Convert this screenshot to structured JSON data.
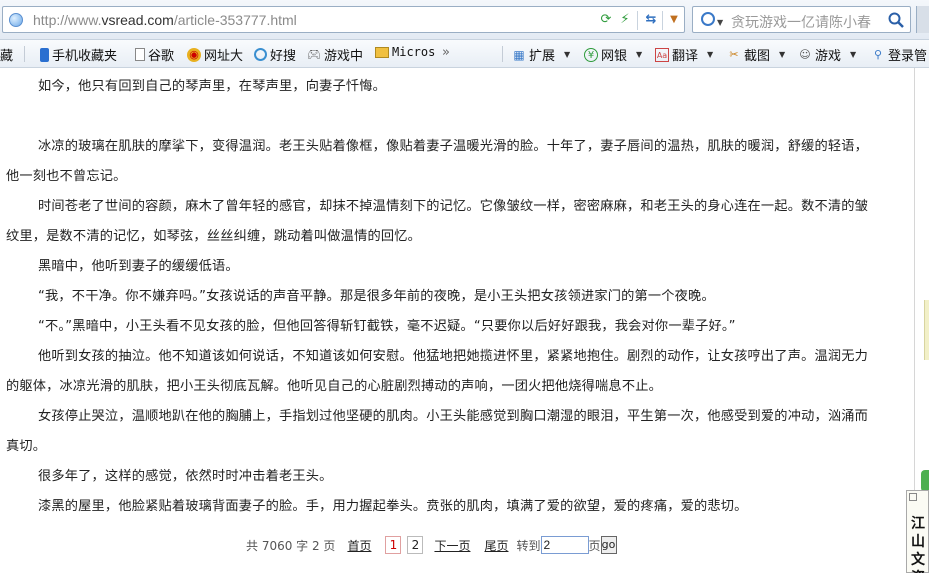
{
  "address_bar": {
    "url_prefix": "http://www.",
    "url_domain": "vsread.com",
    "url_path": "/article-353777.html"
  },
  "search": {
    "placeholder": "贪玩游戏一亿请陈小春"
  },
  "favorites": {
    "items": [
      {
        "label": "藏",
        "icon": "favorites-icon"
      },
      {
        "label": "手机收藏夹",
        "icon": "phone-icon"
      },
      {
        "label": "谷歌",
        "icon": "page-icon"
      },
      {
        "label": "网址大",
        "icon": "compass-icon"
      },
      {
        "label": "好搜",
        "icon": "search-icon"
      },
      {
        "label": "游戏中",
        "icon": "gamepad-icon"
      },
      {
        "label": "Micros",
        "icon": "folder-icon"
      }
    ],
    "overflow": "»",
    "tools": [
      {
        "label": "扩展",
        "icon": "grid-icon"
      },
      {
        "label": "网银",
        "icon": "yen-icon"
      },
      {
        "label": "翻译",
        "icon": "translate-icon"
      },
      {
        "label": "截图",
        "icon": "scissors-icon"
      },
      {
        "label": "游戏",
        "icon": "game-icon"
      },
      {
        "label": "登录管",
        "icon": "key-icon"
      }
    ]
  },
  "article": {
    "paragraphs": [
      "如今，他只有回到自己的琴声里，在琴声里，向妻子忏悔。",
      "冰凉的玻璃在肌肤的摩挲下，变得温润。老王头贴着像框，像贴着妻子温暖光滑的脸。十年了，妻子唇间的温热，肌肤的暖润，舒缓的轻语，他一刻也不曾忘记。",
      "时间苍老了世间的容颜，麻木了曾年轻的感官，却抹不掉温情刻下的记忆。它像皱纹一样，密密麻麻，和老王头的身心连在一起。数不清的皱纹里，是数不清的记忆，如琴弦，丝丝纠缠，跳动着叫做温情的回忆。",
      "黑暗中，他听到妻子的缓缓低语。",
      "“我，不干净。你不嫌弃吗。”女孩说话的声音平静。那是很多年前的夜晚，是小王头把女孩领进家门的第一个夜晚。",
      "“不。”黑暗中，小王头看不见女孩的脸，但他回答得斩钉截铁，毫不迟疑。“只要你以后好好跟我，我会对你一辈子好。”",
      "他听到女孩的抽泣。他不知道该如何说话，不知道该如何安慰。他猛地把她揽进怀里，紧紧地抱住。剧烈的动作，让女孩哼出了声。温润无力的躯体，冰凉光滑的肌肤，把小王头彻底瓦解。他听见自己的心脏剧烈搏动的声响，一团火把他烧得喘息不止。",
      "女孩停止哭泣，温顺地趴在他的胸脯上，手指划过他坚硬的肌肉。小王头能感觉到胸口潮湿的眼泪，平生第一次，他感受到爱的冲动，汹涌而真切。",
      "很多年了，这样的感觉，依然时时冲击着老王头。",
      "漆黑的屋里，他脸紧贴着玻璃背面妻子的脸。手，用力握起拳头。贲张的肌肉，填满了爱的欲望，爱的疼痛，爱的悲切。"
    ]
  },
  "pager": {
    "summary": "共 7060 字 2 页",
    "first": "首页",
    "page1": "1",
    "page2": "2",
    "next": "下一页",
    "last": "尾页",
    "goto_label": "转到",
    "goto_value": "2",
    "page_suffix": "页",
    "go": "go"
  },
  "side_panel": {
    "text": "江山文资"
  }
}
